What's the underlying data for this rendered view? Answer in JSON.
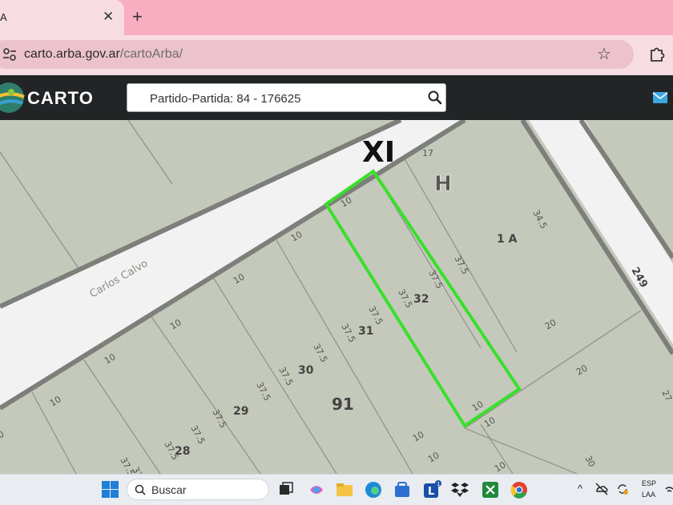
{
  "browser": {
    "tab_title": "A",
    "tab_close": "✕",
    "new_tab": "+",
    "url_host": "carto.arba.gov.ar",
    "url_path": "/cartoArba/"
  },
  "app": {
    "brand": "CARTO",
    "search_value": "Partido-Partida: 84 - 176625"
  },
  "map": {
    "street_names": [
      "Carlos Calvo"
    ],
    "block_labels": [
      "XI",
      "H",
      "91"
    ],
    "parcel_labels": [
      "1 A",
      "32",
      "31",
      "30",
      "29",
      "28"
    ],
    "road_number": "249",
    "dimensions": [
      "17",
      "10",
      "10",
      "10",
      "10",
      "10",
      "10",
      "10",
      "37.5",
      "37.5",
      "37.5",
      "37.5",
      "37.5",
      "37.5",
      "37.5",
      "37.5",
      "37.5",
      "37.5",
      "37.5",
      "37.5",
      "34.5",
      "20",
      "20",
      "10",
      "10",
      "10",
      "10",
      "30",
      "27",
      "0",
      "37"
    ],
    "colors": {
      "parcel_fill": "#c5c9bb",
      "street": "#f2f2f2",
      "highlight": "#39e02b"
    }
  },
  "taskbar": {
    "search_label": "Buscar",
    "lang_line1": "ESP",
    "lang_line2": "LAA",
    "notification_badge": "1"
  }
}
